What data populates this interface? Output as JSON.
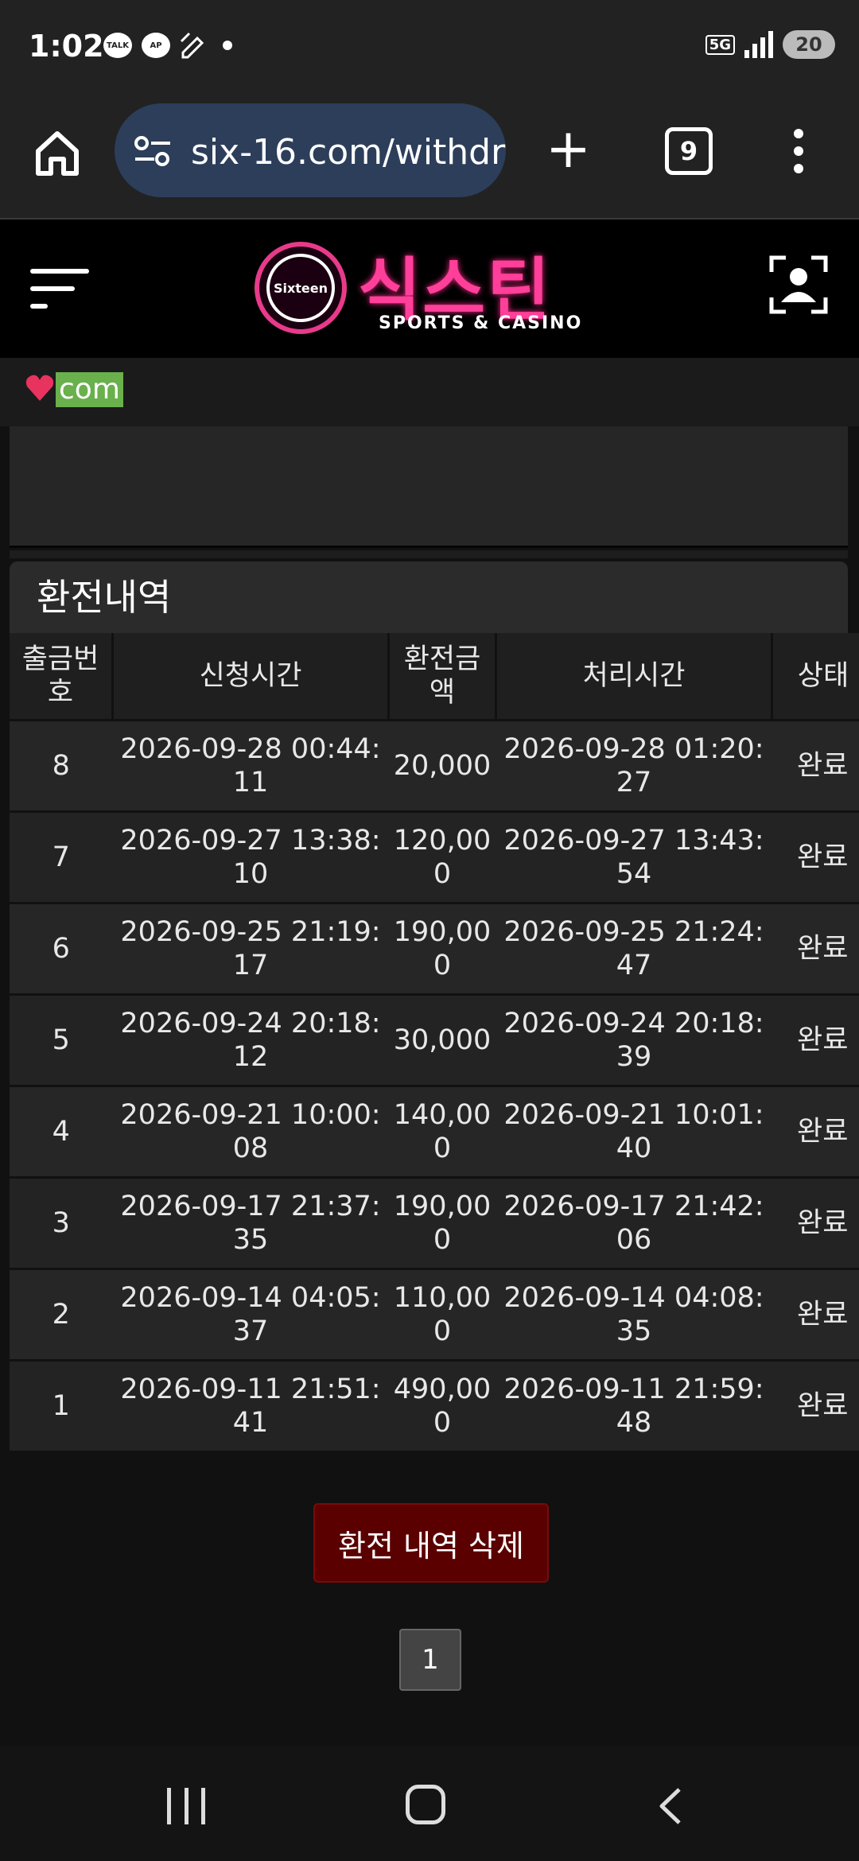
{
  "status_bar": {
    "time": "1:02",
    "talk_badge": "TALK",
    "ap_badge": "AP",
    "network": "5G",
    "battery": "20"
  },
  "browser": {
    "url": "six-16.com/withdr",
    "tab_count": "9"
  },
  "site": {
    "logo_badge": "Sixteen",
    "logo_ko": "식스틴",
    "logo_en": "SPORTS & CASINO",
    "sub_brand": "com"
  },
  "history": {
    "title": "환전내역",
    "columns": [
      "출금번호",
      "신청시간",
      "환전금액",
      "처리시간",
      "상태"
    ],
    "rows": [
      {
        "no": "8",
        "requested": "2026-09-28 00:44:11",
        "amount": "20,000",
        "processed": "2026-09-28 01:20:27",
        "status": "완료"
      },
      {
        "no": "7",
        "requested": "2026-09-27 13:38:10",
        "amount": "120,000",
        "processed": "2026-09-27 13:43:54",
        "status": "완료"
      },
      {
        "no": "6",
        "requested": "2026-09-25 21:19:17",
        "amount": "190,000",
        "processed": "2026-09-25 21:24:47",
        "status": "완료"
      },
      {
        "no": "5",
        "requested": "2026-09-24 20:18:12",
        "amount": "30,000",
        "processed": "2026-09-24 20:18:39",
        "status": "완료"
      },
      {
        "no": "4",
        "requested": "2026-09-21 10:00:08",
        "amount": "140,000",
        "processed": "2026-09-21 10:01:40",
        "status": "완료"
      },
      {
        "no": "3",
        "requested": "2026-09-17 21:37:35",
        "amount": "190,000",
        "processed": "2026-09-17 21:42:06",
        "status": "완료"
      },
      {
        "no": "2",
        "requested": "2026-09-14 04:05:37",
        "amount": "110,000",
        "processed": "2026-09-14 04:08:35",
        "status": "완료"
      },
      {
        "no": "1",
        "requested": "2026-09-11 21:51:41",
        "amount": "490,000",
        "processed": "2026-09-11 21:59:48",
        "status": "완료"
      }
    ],
    "delete_label": "환전 내역 삭제",
    "current_page": "1"
  },
  "colors": {
    "accent": "#ff3f9a",
    "delete_bg": "#5a0000",
    "page_bg": "#111111"
  }
}
